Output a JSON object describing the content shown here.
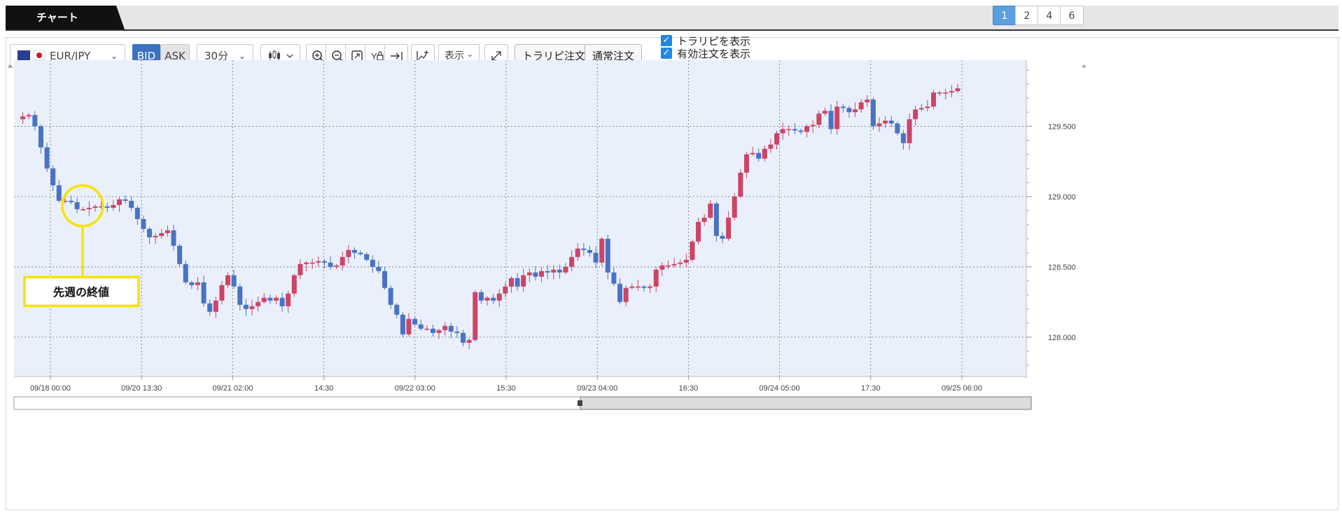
{
  "window": {
    "title": "チャート",
    "pages": [
      "1",
      "2",
      "4",
      "6"
    ],
    "active_page": "1"
  },
  "toolbar": {
    "symbol": "EUR/JPY",
    "bid_label": "BID",
    "ask_label": "ASK",
    "timeframe": "30分",
    "display_label": "表示",
    "traripi_order_label": "トラリピ注文",
    "normal_order_label": "通常注文",
    "show_traripi_label": "トラリピを表示",
    "show_active_orders_label": "有効注文を表示",
    "show_traripi_checked": true,
    "show_active_orders_checked": true
  },
  "annotation": {
    "label": "先週の終値"
  },
  "colors": {
    "up": "#cc4466",
    "down": "#4a72c4",
    "plot_bg": "#e9f0fb",
    "accent": "#5b9fde",
    "callout": "#f5e400"
  },
  "chart_data": {
    "type": "candlestick",
    "pair": "EUR/JPY",
    "y_ticks": [
      "129.500",
      "129.000",
      "128.500",
      "128.000"
    ],
    "x_ticks": [
      "09/18 00:00",
      "09/20 13:30",
      "09/21 02:00",
      "14:30",
      "09/22 03:00",
      "15:30",
      "09/23 04:00",
      "16:30",
      "09/24 05:00",
      "17:30",
      "09/25 06:00"
    ],
    "ylim": [
      127.72,
      129.97
    ],
    "grid": true,
    "close_series": [
      129.55,
      129.57,
      129.58,
      129.5,
      129.35,
      129.2,
      129.08,
      128.97,
      128.97,
      128.96,
      128.91,
      128.91,
      128.92,
      128.93,
      128.93,
      128.92,
      128.94,
      128.98,
      128.97,
      128.92,
      128.84,
      128.77,
      128.71,
      128.72,
      128.74,
      128.76,
      128.65,
      128.52,
      128.39,
      128.37,
      128.39,
      128.24,
      128.18,
      128.26,
      128.37,
      128.44,
      128.36,
      128.23,
      128.2,
      128.22,
      128.25,
      128.28,
      128.26,
      128.28,
      128.22,
      128.31,
      128.44,
      128.52,
      128.53,
      128.53,
      128.54,
      128.53,
      128.5,
      128.51,
      128.57,
      128.62,
      128.6,
      128.59,
      128.55,
      128.5,
      128.47,
      128.35,
      128.23,
      128.16,
      128.02,
      128.13,
      128.09,
      128.06,
      128.06,
      128.03,
      128.05,
      128.08,
      128.04,
      128.03,
      127.96,
      127.98,
      128.32,
      128.26,
      128.28,
      128.26,
      128.31,
      128.36,
      128.42,
      128.36,
      128.44,
      128.46,
      128.43,
      128.47,
      128.46,
      128.48,
      128.46,
      128.5,
      128.57,
      128.63,
      128.62,
      128.6,
      128.53,
      128.7,
      128.46,
      128.38,
      128.25,
      128.35,
      128.36,
      128.36,
      128.35,
      128.36,
      128.48,
      128.51,
      128.51,
      128.52,
      128.53,
      128.55,
      128.68,
      128.82,
      128.85,
      128.95,
      128.72,
      128.7,
      128.85,
      129.0,
      129.17,
      129.3,
      129.31,
      129.27,
      129.34,
      129.37,
      129.45,
      129.48,
      129.48,
      129.47,
      129.46,
      129.5,
      129.51,
      129.59,
      129.61,
      129.48,
      129.64,
      129.63,
      129.6,
      129.62,
      129.67,
      129.69,
      129.5,
      129.52,
      129.54,
      129.52,
      129.45,
      129.38,
      129.55,
      129.62,
      129.63,
      129.64,
      129.74,
      129.74,
      129.74,
      129.75,
      129.77
    ]
  }
}
